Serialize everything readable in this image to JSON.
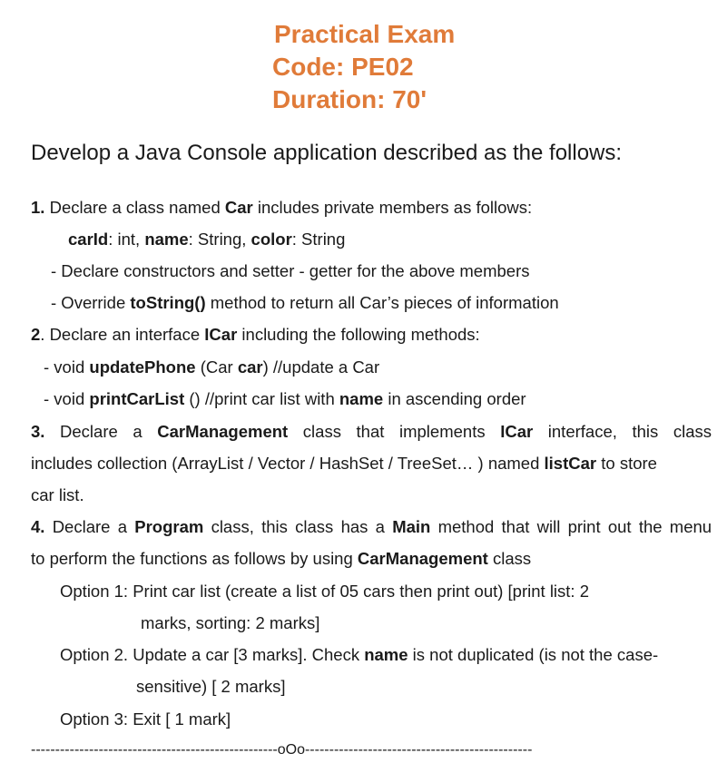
{
  "header": {
    "title": "Practical Exam",
    "code": "Code: PE02",
    "duration": "Duration: 70'"
  },
  "intro": "Develop a Java Console application described as the follows:",
  "q1": {
    "num": "1.",
    "t1": " Declare a class named ",
    "class_name": "Car",
    "t2": " includes private members as follows:",
    "m_carId": "carId",
    "m_carId_type": ": int, ",
    "m_name": "name",
    "m_name_type": ": String, ",
    "m_color": "color",
    "m_color_type": ": String",
    "line3": "- Declare constructors and setter - getter for the above members",
    "l4a": "- Override ",
    "l4b": "toString()",
    "l4c": " method to return all Car’s pieces of  information"
  },
  "q2": {
    "num": "2",
    "t1": ". Declare an interface ",
    "iface": "ICar",
    "t2": " including the following methods:",
    "m1a": "- void ",
    "m1b": "updatePhone",
    "m1c": " (Car ",
    "m1d": "car",
    "m1e": ")   //update a Car",
    "m2a": "- void ",
    "m2b": "printCarList",
    "m2c": " ()  //print car list with ",
    "m2d": "name",
    "m2e": " in ascending order"
  },
  "q3": {
    "w": [
      "3.",
      "Declare",
      "a",
      "CarManagement",
      "class",
      "that",
      "implements",
      "ICar",
      "interface,",
      "this",
      "class"
    ],
    "l2a": "includes collection (ArrayList / Vector / HashSet  / TreeSet… ) named ",
    "l2b": "listCar",
    "l2c": " to store",
    "l3": "car list."
  },
  "q4": {
    "w": [
      "4.",
      "Declare",
      "a",
      "Program",
      "class,",
      "this",
      "class",
      "has",
      "a",
      "Main",
      "method",
      "that",
      "will",
      "print",
      "out",
      "the",
      "menu"
    ],
    "l2a": "to perform the functions as follows by using ",
    "l2b": "CarManagement",
    "l2c": " class",
    "o1a": "Option 1: Print car list (create a list of 05 cars then print out) [print list: 2",
    "o1b": "marks, sorting: 2 marks]",
    "o2a": "Option 2. Update a car [3 marks]. Check ",
    "o2b": "name",
    "o2c": " is not duplicated (is not the case-",
    "o2d": "sensitive) [ 2 marks]",
    "o3": "Option 3: Exit [ 1 mark]"
  },
  "footer": "---------------------------------------------------oOo-----------------------------------------------"
}
